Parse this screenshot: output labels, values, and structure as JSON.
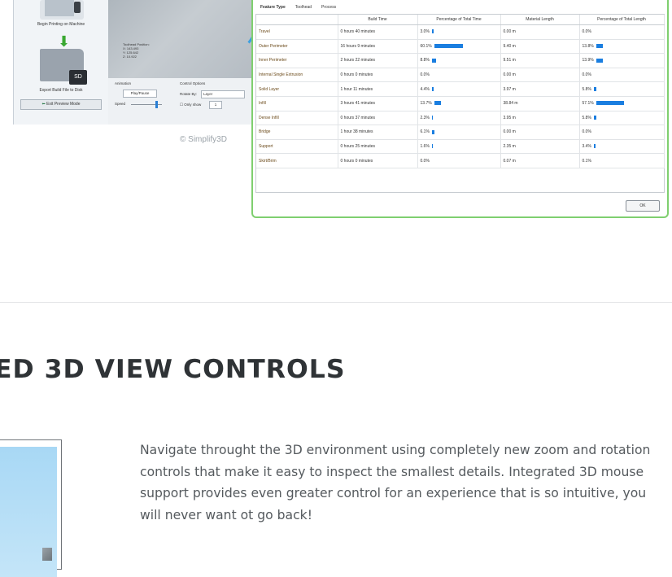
{
  "left_panel": {
    "begin_printing_label": "Begin Printing on Machine",
    "export_label": "Export Build File to Disk",
    "exit_preview_label": "Exit Preview Mode",
    "toolhead_info": [
      "Toolhead Position:",
      "X: 143.493",
      "Y: 125.642",
      "Z: 10.922"
    ],
    "animation_label": "Animation",
    "play_pause_label": "Play/Pause",
    "speed_label": "Speed",
    "control_options_label": "Control Options",
    "rotate_by_label": "Rotate By:",
    "rotate_by_value": "Layer",
    "only_show_label": "Only show",
    "only_show_value": "1",
    "sd_label": "SD"
  },
  "watermark": "© Simplify3D",
  "dialog": {
    "tabs": [
      "Feature Type",
      "Toolhead",
      "Process"
    ],
    "active_tab": "Feature Type",
    "columns": [
      "",
      "Build Time",
      "Percentage of Total Time",
      "Material Length",
      "Percentage of Total Length"
    ],
    "rows": [
      {
        "name": "Travel",
        "time": "0 hours 40 minutes",
        "pct_time": "3.0%",
        "time_frac": 0.03,
        "length": "0.00 m",
        "pct_len": "0.0%",
        "len_frac": 0.0
      },
      {
        "name": "Outer Perimeter",
        "time": "16 hours 9 minutes",
        "pct_time": "60.1%",
        "time_frac": 0.601,
        "length": "9.40 m",
        "pct_len": "13.8%",
        "len_frac": 0.138
      },
      {
        "name": "Inner Perimeter",
        "time": "2 hours 22 minutes",
        "pct_time": "8.8%",
        "time_frac": 0.088,
        "length": "9.51 m",
        "pct_len": "13.9%",
        "len_frac": 0.139
      },
      {
        "name": "Internal Single Extrusion",
        "time": "0 hours 0 minutes",
        "pct_time": "0.0%",
        "time_frac": 0.0,
        "length": "0.00 m",
        "pct_len": "0.0%",
        "len_frac": 0.0
      },
      {
        "name": "Solid Layer",
        "time": "1 hour 11 minutes",
        "pct_time": "4.4%",
        "time_frac": 0.044,
        "length": "3.97 m",
        "pct_len": "5.8%",
        "len_frac": 0.058
      },
      {
        "name": "Infill",
        "time": "3 hours 41 minutes",
        "pct_time": "13.7%",
        "time_frac": 0.137,
        "length": "38.84 m",
        "pct_len": "57.1%",
        "len_frac": 0.571
      },
      {
        "name": "Dense Infill",
        "time": "0 hours 37 minutes",
        "pct_time": "2.3%",
        "time_frac": 0.023,
        "length": "3.95 m",
        "pct_len": "5.8%",
        "len_frac": 0.058
      },
      {
        "name": "Bridge",
        "time": "1 hour 38 minutes",
        "pct_time": "6.1%",
        "time_frac": 0.061,
        "length": "0.00 m",
        "pct_len": "0.0%",
        "len_frac": 0.0
      },
      {
        "name": "Support",
        "time": "0 hours 25 minutes",
        "pct_time": "1.6%",
        "time_frac": 0.016,
        "length": "2.35 m",
        "pct_len": "3.4%",
        "len_frac": 0.034
      },
      {
        "name": "Skirt/Brim",
        "time": "0 hours 0 minutes",
        "pct_time": "0.0%",
        "time_frac": 0.0,
        "length": "0.07 m",
        "pct_len": "0.1%",
        "len_frac": 0.001
      }
    ],
    "ok_label": "OK",
    "bar_color": "#1a7ee0"
  },
  "section": {
    "heading": "ED 3D VIEW CONTROLS",
    "description": "Navigate throught the 3D environment using completely new zoom and rotation controls that make it easy to inspect the smallest details. Integrated 3D mouse support provides even greater control for an experience that is so intuitive, you will never want ot go back!"
  }
}
